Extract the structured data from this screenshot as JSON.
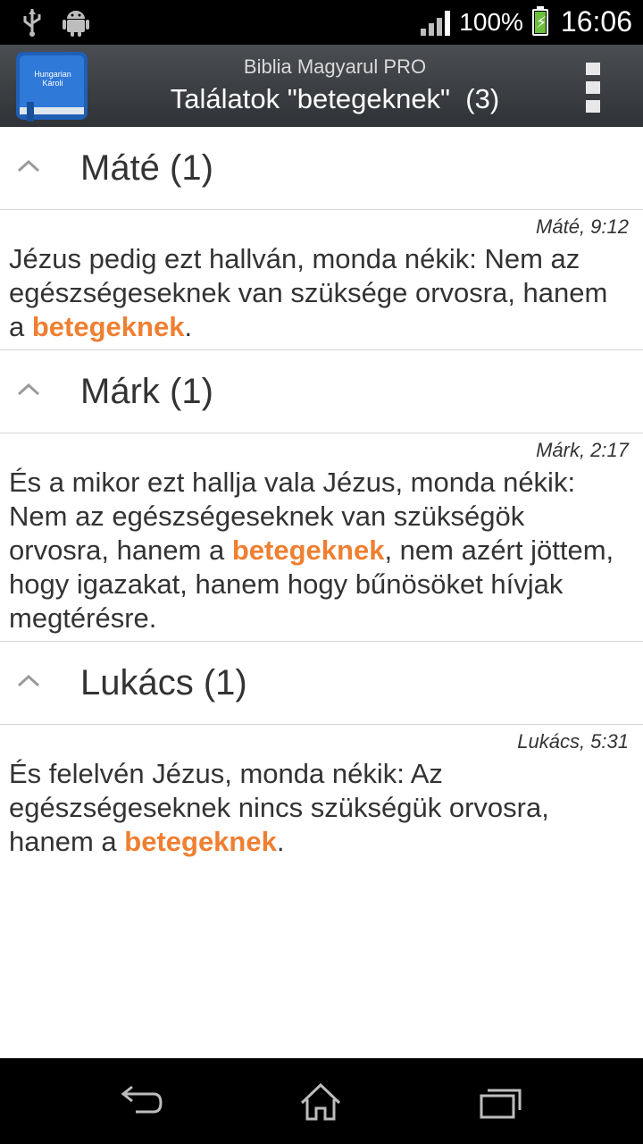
{
  "status_bar": {
    "battery_text": "100%",
    "clock": "16:06",
    "icons": [
      "usb-icon",
      "android-debug-icon",
      "signal-icon",
      "battery-charging-icon"
    ]
  },
  "action_bar": {
    "app_name": "Biblia Magyarul PRO",
    "title": "Találatok \"betegeknek\"  (3)",
    "app_icon_label_line1": "Hungarian",
    "app_icon_label_line2": "Károli",
    "overflow_icon": "overflow-menu-icon"
  },
  "groups": [
    {
      "title": "Máté (1)",
      "verse": {
        "ref": "Máté, 9:12",
        "before": "Jézus pedig ezt hallván, monda nékik: Nem az egészségeseknek van szüksége orvosra, hanem a ",
        "highlight": "betegeknek",
        "after": "."
      }
    },
    {
      "title": "Márk (1)",
      "verse": {
        "ref": "Márk, 2:17",
        "before": "És a mikor ezt hallja vala Jézus, monda nékik: Nem az egészségeseknek van szükségök orvosra, hanem a ",
        "highlight": "betegeknek",
        "after": ", nem azért jöttem, hogy igazakat, hanem hogy bűnösöket hívjak megtérésre."
      }
    },
    {
      "title": "Lukács (1)",
      "verse": {
        "ref": "Lukács, 5:31",
        "before": "És felelvén Jézus, monda nékik: Az egészségeseknek nincs szükségük orvosra, hanem a ",
        "highlight": "betegeknek",
        "after": "."
      }
    }
  ],
  "colors": {
    "highlight": "#ef7f31",
    "text": "#333333",
    "action_bar": "#3c3f43"
  },
  "nav_bar": {
    "icons": [
      "back-icon",
      "home-icon",
      "recent-apps-icon"
    ]
  }
}
